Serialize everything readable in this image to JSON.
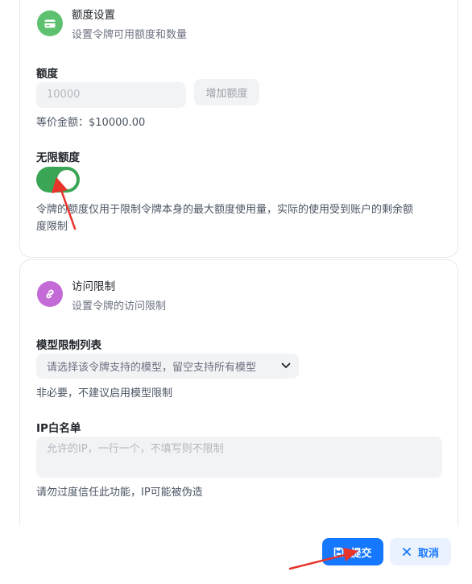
{
  "quota_section": {
    "title": "额度设置",
    "subtitle": "设置令牌可用额度和数量",
    "quota_label": "额度",
    "quota_placeholder": "10000",
    "add_quota_button": "增加额度",
    "equivalent_amount": "等价金额：$10000.00",
    "unlimited_label": "无限额度",
    "unlimited_enabled": true,
    "unlimited_hint_line1": "令牌的额度仅用于限制令牌本身的最大额度使用量，实际的使用受到账户的剩余额",
    "unlimited_hint_line2": "度限制",
    "icon_color": "#5ec16f"
  },
  "access_section": {
    "title": "访问限制",
    "subtitle": "设置令牌的访问限制",
    "model_label": "模型限制列表",
    "model_placeholder": "请选择该令牌支持的模型，留空支持所有模型",
    "model_hint": "非必要，不建议启用模型限制",
    "ip_label": "IP白名单",
    "ip_placeholder": "允许的IP，一行一个，不填写则不限制",
    "ip_hint": "请勿过度信任此功能，IP可能被伪造",
    "icon_color": "#c36ad6"
  },
  "footer": {
    "submit_label": "提交",
    "cancel_label": "取消"
  },
  "colors": {
    "primary": "#1677ff",
    "toggle_on": "#3aa655",
    "annotation_arrow": "#e8332a"
  }
}
